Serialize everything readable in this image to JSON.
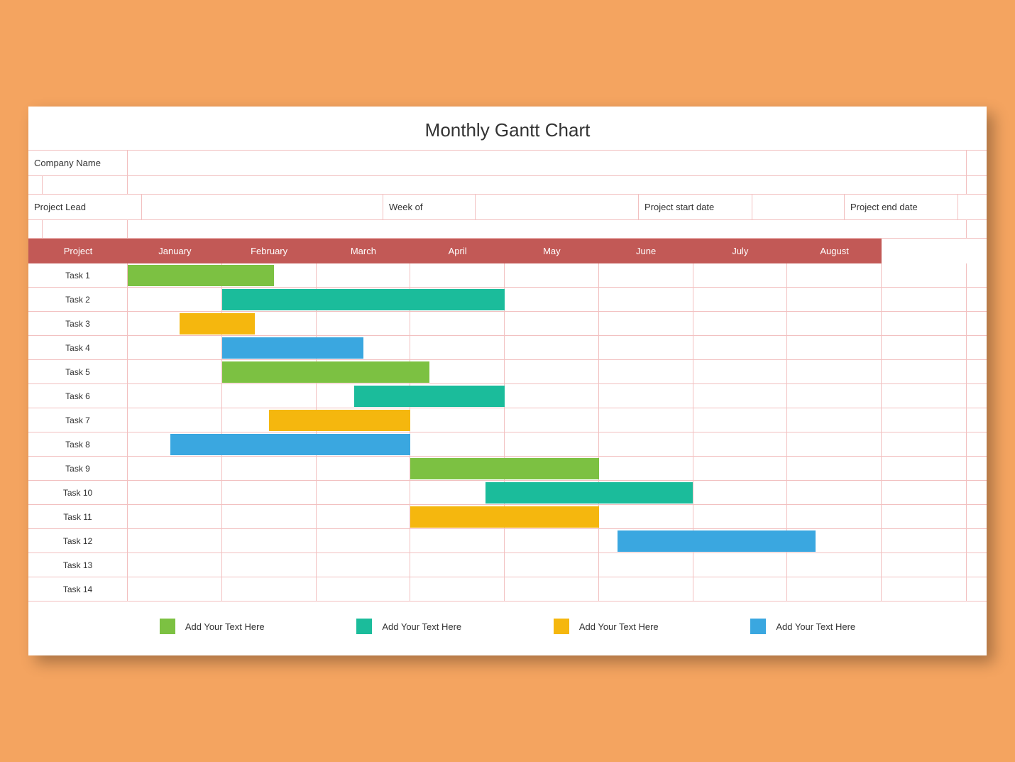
{
  "title": "Monthly Gantt Chart",
  "meta": {
    "company_name_label": "Company Name",
    "project_lead_label": "Project Lead",
    "week_of_label": "Week of",
    "project_start_label": "Project start date",
    "project_end_label": "Project end date"
  },
  "header_project": "Project",
  "months": [
    "January",
    "February",
    "March",
    "April",
    "May",
    "June",
    "July",
    "August"
  ],
  "colors": {
    "green": "#7cc142",
    "teal": "#1bbc9b",
    "yellow": "#f5b70e",
    "blue": "#3aa7e0"
  },
  "legend": [
    {
      "color": "green",
      "label": "Add Your Text Here"
    },
    {
      "color": "teal",
      "label": "Add Your Text Here"
    },
    {
      "color": "yellow",
      "label": "Add Your Text Here"
    },
    {
      "color": "blue",
      "label": "Add Your Text Here"
    }
  ],
  "chart_data": {
    "type": "bar",
    "title": "Monthly Gantt Chart",
    "xlabel": "",
    "ylabel": "",
    "categories": [
      "January",
      "February",
      "March",
      "April",
      "May",
      "June",
      "July",
      "August"
    ],
    "tasks": [
      {
        "name": "Task 1",
        "color": "green",
        "start": 0.0,
        "end": 1.55
      },
      {
        "name": "Task 2",
        "color": "teal",
        "start": 1.0,
        "end": 4.0
      },
      {
        "name": "Task 3",
        "color": "yellow",
        "start": 0.55,
        "end": 1.35
      },
      {
        "name": "Task 4",
        "color": "blue",
        "start": 1.0,
        "end": 2.5
      },
      {
        "name": "Task 5",
        "color": "green",
        "start": 1.0,
        "end": 3.2
      },
      {
        "name": "Task 6",
        "color": "teal",
        "start": 2.4,
        "end": 4.0
      },
      {
        "name": "Task 7",
        "color": "yellow",
        "start": 1.5,
        "end": 3.0
      },
      {
        "name": "Task 8",
        "color": "blue",
        "start": 0.45,
        "end": 3.0
      },
      {
        "name": "Task 9",
        "color": "green",
        "start": 3.0,
        "end": 5.0
      },
      {
        "name": "Task 10",
        "color": "teal",
        "start": 3.8,
        "end": 6.0
      },
      {
        "name": "Task 11",
        "color": "yellow",
        "start": 3.0,
        "end": 5.0
      },
      {
        "name": "Task 12",
        "color": "blue",
        "start": 5.2,
        "end": 7.3
      },
      {
        "name": "Task 13"
      },
      {
        "name": "Task 14"
      }
    ]
  }
}
